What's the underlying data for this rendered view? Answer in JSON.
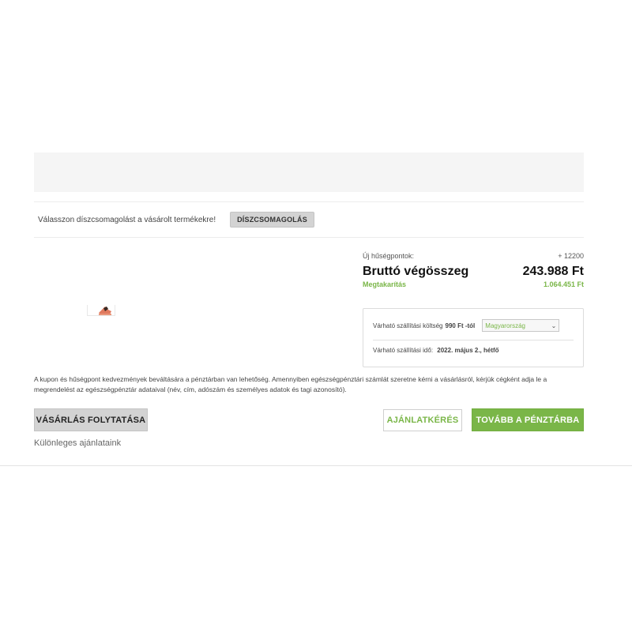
{
  "product": {
    "thumbnail_icon": "product-thumbnail-image"
  },
  "gift_wrap": {
    "prompt": "Válasszon díszcsomagolást a vásárolt termékekre!",
    "button_label": "DÍSZCSOMAGOLÁS"
  },
  "summary": {
    "points_label": "Új hűségpontok:",
    "points_value": "+ 12200",
    "total_label": "Bruttó végösszeg",
    "total_value": "243.988 Ft",
    "savings_label": "Megtakarítás",
    "savings_value": "1.064.451 Ft"
  },
  "shipping": {
    "cost_prefix": "Várható szállítási költség",
    "cost_value": "990 Ft -tól",
    "country_selected": "Magyarország",
    "time_prefix": "Várható szállítási idő:",
    "time_value": "2022. május 2., hétfő"
  },
  "notice": "A kupon és hűségpont kedvezmények beváltására a pénztárban van lehetőség. Amennyiben egészségpénztári számlát szeretne kérni a vásárlásról, kérjük cégként adja le a megrendelést az egészségpénztár adataival (név, cím, adószám és személyes adatok és tagi azonosító).",
  "buttons": {
    "continue": "VÁSÁRLÁS FOLYTATÁSA",
    "quote": "AJÁNLATKÉRÉS",
    "checkout": "TOVÁBB A PÉNZTÁRBA"
  },
  "offers_heading": "Különleges ajánlataink",
  "colors": {
    "accent_green": "#7ab648",
    "button_gray": "#d3d3d3"
  }
}
